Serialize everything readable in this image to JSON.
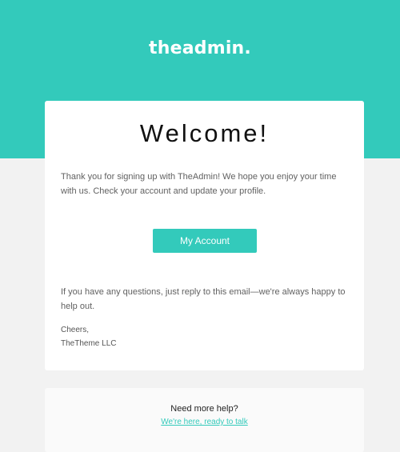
{
  "brand": {
    "logo": "theadmin.",
    "accent_color": "#33cabb"
  },
  "email": {
    "heading": "Welcome!",
    "intro": "Thank you for signing up with TheAdmin! We hope you enjoy your time with us. Check your account and update your profile.",
    "cta_label": "My Account",
    "followup": "If you have any questions, just reply to this email—we're always happy to help out.",
    "signoff_line1": "Cheers,",
    "signoff_line2": "TheTheme LLC"
  },
  "help": {
    "title": "Need more help?",
    "link_label": "We're here, ready to talk"
  }
}
